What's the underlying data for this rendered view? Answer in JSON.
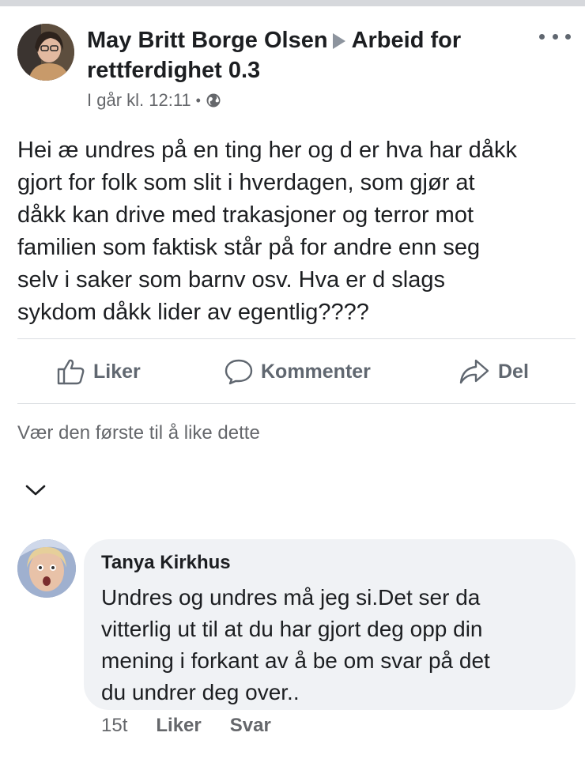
{
  "post": {
    "author": "May Britt Borge Olsen",
    "group": "Arbeid for rettferdighet 0.3",
    "timestamp": "I går kl. 12:11",
    "separator": "•",
    "privacy_icon": "globe-icon",
    "more_icon": "more-options-icon",
    "text": "Hei æ undres på en ting her og d er hva har dåkk\ngjort for folk som slit i hverdagen, som gjør at\ndåkk kan drive med trakasjoner og terror mot\nfamilien som faktisk står på for andre enn seg\nselv i saker som barnv osv. Hva er d slags\nsykdom dåkk lider av egentlig????"
  },
  "actions": {
    "like_label": "Liker",
    "comment_label": "Kommenter",
    "share_label": "Del"
  },
  "reactions": {
    "summary": "Vær den første til å like dette"
  },
  "comment": {
    "author": "Tanya Kirkhus",
    "text": "Undres og undres må jeg si.Det ser da\nvitterlig ut til at du har gjort deg opp din\nmening i forkant av å be om svar på det\ndu undrer deg over..",
    "time": "15t",
    "like_label": "Liker",
    "reply_label": "Svar"
  },
  "colors": {
    "text_primary": "#1c1e21",
    "text_secondary": "#65676b",
    "bubble_bg": "#f0f2f5",
    "divider": "#dadde1"
  }
}
